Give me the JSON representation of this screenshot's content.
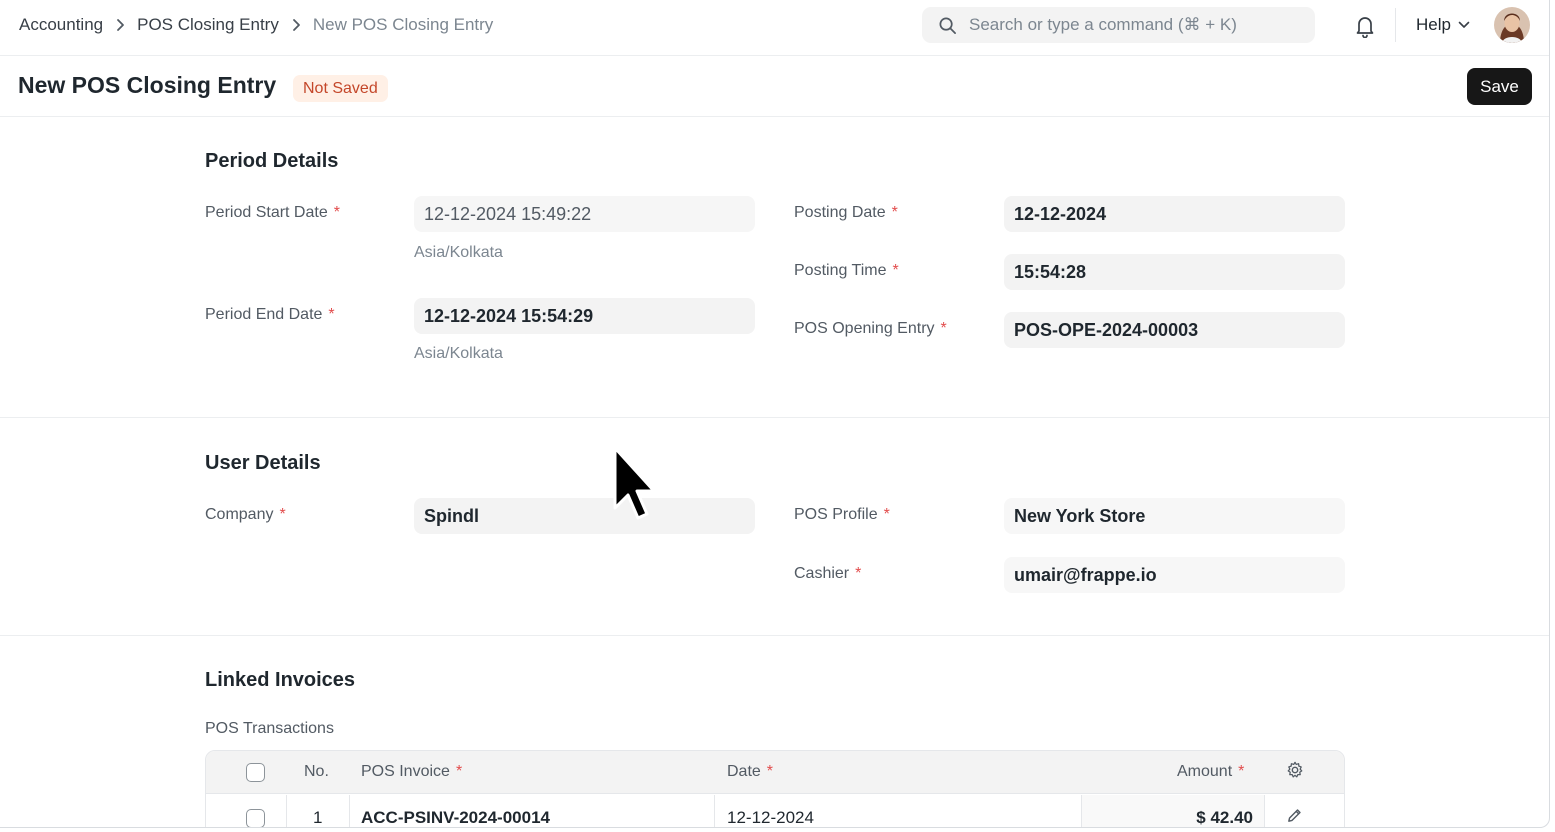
{
  "navbar": {
    "breadcrumbs": [
      "Accounting",
      "POS Closing Entry",
      "New POS Closing Entry"
    ],
    "search_placeholder": "Search or type a command (⌘ + K)",
    "help_label": "Help"
  },
  "page": {
    "title": "New POS Closing Entry",
    "status": "Not Saved",
    "save_label": "Save"
  },
  "period_details": {
    "title": "Period Details",
    "start_date": {
      "label": "Period Start Date",
      "value": "12-12-2024 15:49:22",
      "hint": "Asia/Kolkata"
    },
    "end_date": {
      "label": "Period End Date",
      "value": "12-12-2024 15:54:29",
      "hint": "Asia/Kolkata"
    },
    "posting_date": {
      "label": "Posting Date",
      "value": "12-12-2024"
    },
    "posting_time": {
      "label": "Posting Time",
      "value": "15:54:28"
    },
    "opening_entry": {
      "label": "POS Opening Entry",
      "value": "POS-OPE-2024-00003"
    }
  },
  "user_details": {
    "title": "User Details",
    "company": {
      "label": "Company",
      "value": "Spindl"
    },
    "pos_profile": {
      "label": "POS Profile",
      "value": "New York Store"
    },
    "cashier": {
      "label": "Cashier",
      "value": "umair@frappe.io"
    }
  },
  "linked_invoices": {
    "title": "Linked Invoices",
    "table_label": "POS Transactions",
    "columns": {
      "no": "No.",
      "invoice": "POS Invoice",
      "date": "Date",
      "amount": "Amount"
    },
    "rows": [
      {
        "no": "1",
        "invoice": "ACC-PSINV-2024-00014",
        "date": "12-12-2024",
        "amount": "$ 42.40"
      }
    ]
  },
  "required_marker": "*",
  "colors": {
    "primary_button": "#171717",
    "status_badge_bg": "#fff0e6",
    "status_badge_text": "#c4472a",
    "required": "#e24c4c"
  }
}
